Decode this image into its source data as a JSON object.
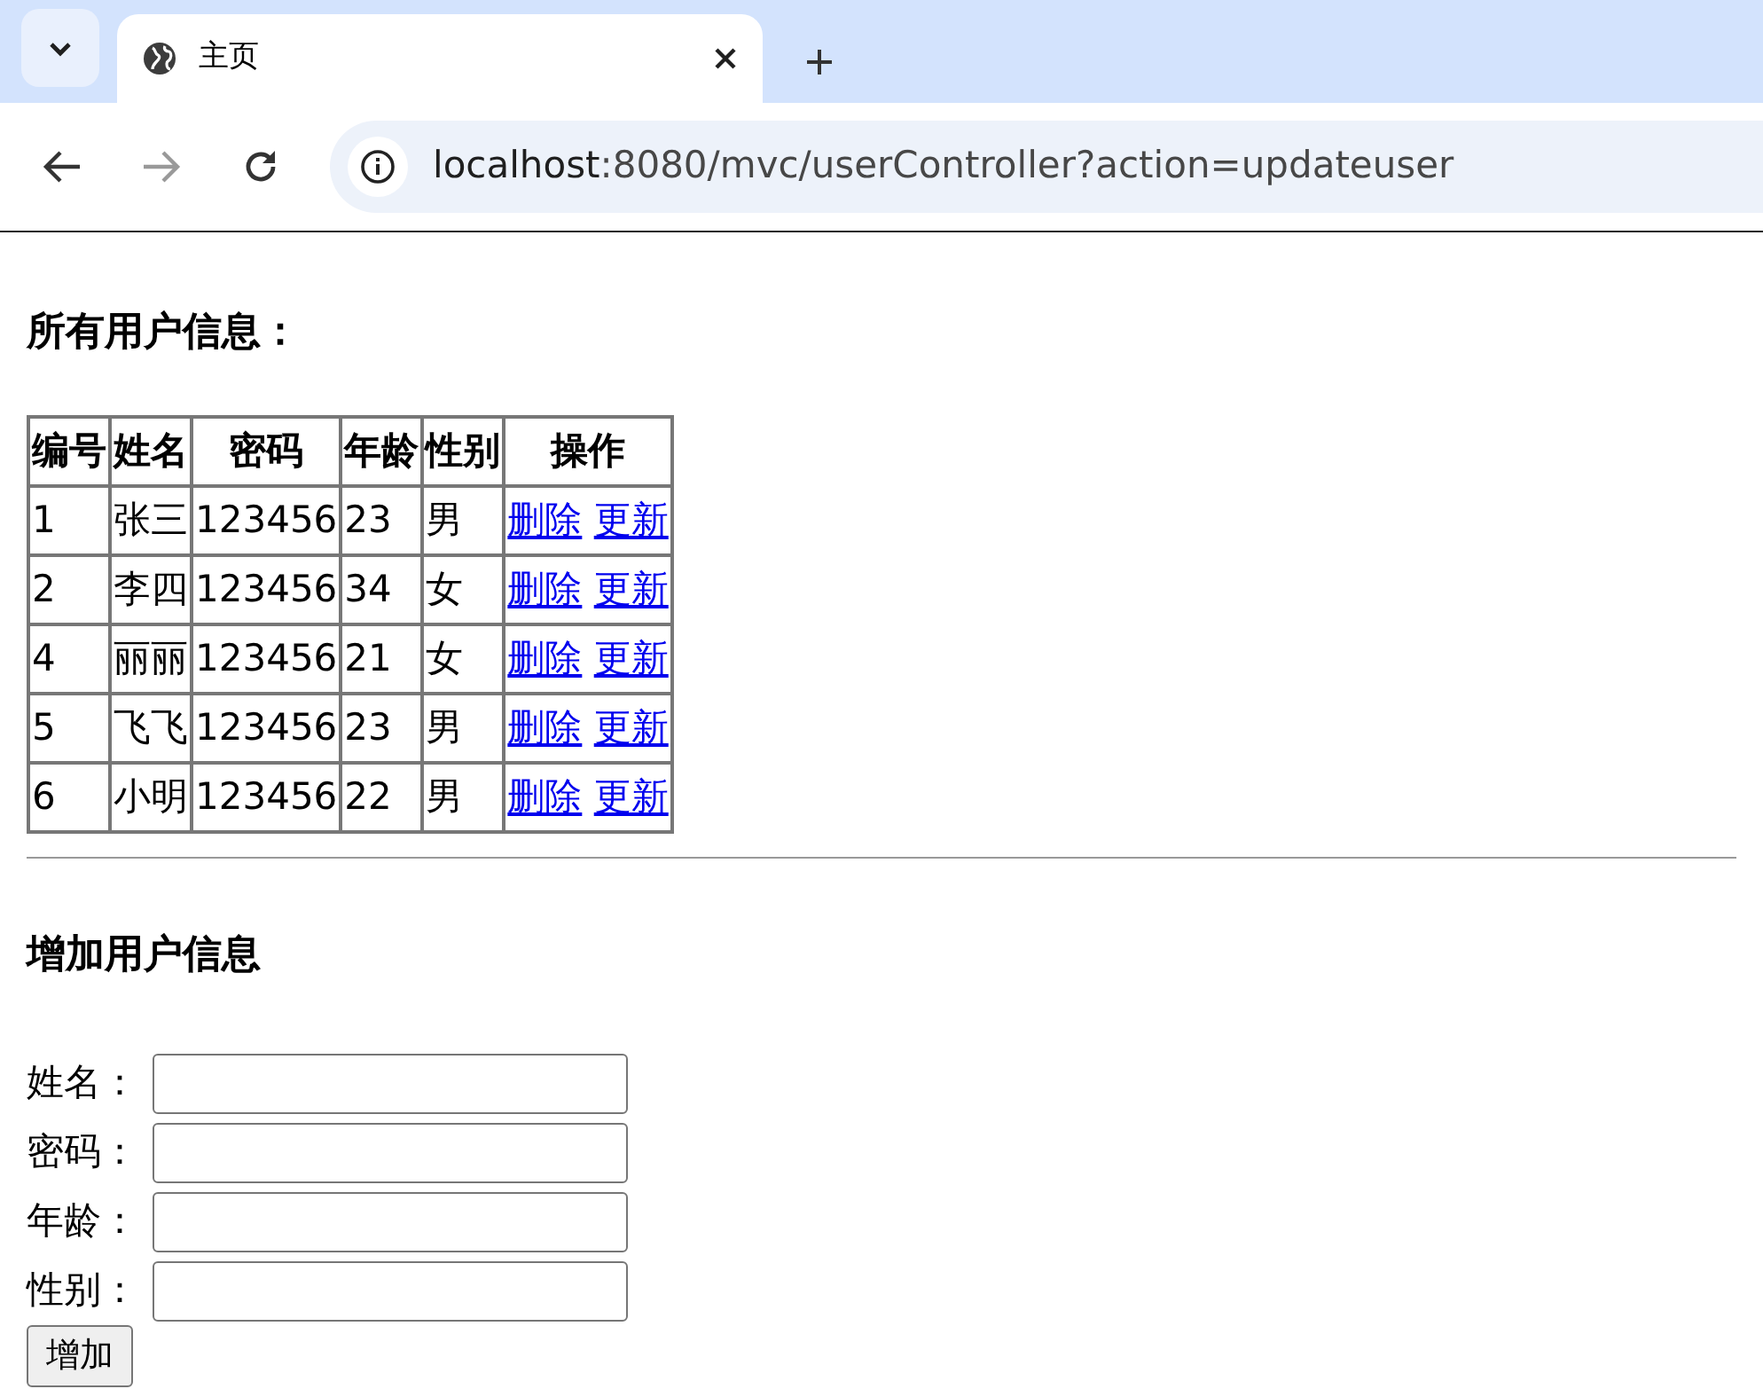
{
  "browser": {
    "tabs": [
      {
        "title": "主页",
        "selected": true
      }
    ],
    "url_host": "localhost",
    "url_rest": ":8080/mvc/userController?action=updateuser"
  },
  "users_heading": "所有用户信息：",
  "table": {
    "columns": [
      "编号",
      "姓名",
      "密码",
      "年龄",
      "性别",
      "操作"
    ],
    "rows": [
      {
        "cells": [
          "1",
          "张三",
          "123456",
          "23",
          "男"
        ],
        "links": [
          "删除",
          "更新"
        ]
      },
      {
        "cells": [
          "2",
          "李四",
          "123456",
          "34",
          "女"
        ],
        "links": [
          "删除",
          "更新"
        ]
      },
      {
        "cells": [
          "4",
          "丽丽",
          "123456",
          "21",
          "女"
        ],
        "links": [
          "删除",
          "更新"
        ]
      },
      {
        "cells": [
          "5",
          "飞飞",
          "123456",
          "23",
          "男"
        ],
        "links": [
          "删除",
          "更新"
        ]
      },
      {
        "cells": [
          "6",
          "小明",
          "123456",
          "22",
          "男"
        ],
        "links": [
          "删除",
          "更新"
        ]
      }
    ]
  },
  "add_heading": "增加用户信息",
  "form": {
    "fields": [
      {
        "label": "姓名："
      },
      {
        "label": "密码："
      },
      {
        "label": "年龄："
      },
      {
        "label": "性别："
      }
    ],
    "submit": "增加"
  }
}
